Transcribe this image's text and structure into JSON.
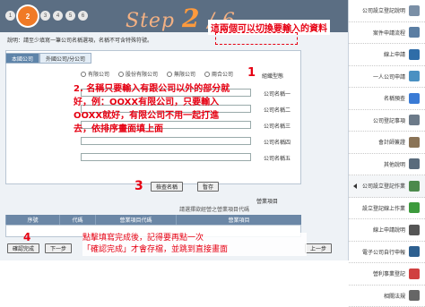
{
  "header": {
    "step_prefix": "Step",
    "step_number": "2",
    "step_suffix": "/ 6",
    "steps": [
      "1",
      "2",
      "3",
      "4",
      "5",
      "6"
    ],
    "current_step": "2"
  },
  "callouts": {
    "top": "這兩個可以切換要輸入的資料",
    "c1": "1",
    "c2_line1": "2. 名稱只要輸入有跟公司以外的部分就",
    "c2_line2": "好，例：OOXX有限公司，只要輸入",
    "c2_line3": "OOXX就好，有限公司不用一起打進",
    "c2_line4": "去，依排序畫面填上面",
    "c3": "3",
    "c4": "4",
    "bottom_line1": "點擊填寫完成後，記得要再點一次",
    "bottom_line2": "「確認完成」才會存檔，並跳到直接畫面"
  },
  "description": "說明：請至少填寫一筆公司名稱選項，名稱不可含特殊符號。",
  "tabs": [
    "本國公司",
    "外國公司/分公司"
  ],
  "form": {
    "type_label": "組織型態",
    "options": [
      "有限公司",
      "股份有限公司",
      "無限公司",
      "兩合公司"
    ],
    "name_labels": [
      "公司名稱一",
      "公司名稱二",
      "公司名稱三",
      "公司名稱四",
      "公司名稱五"
    ],
    "btn_save": "暫存",
    "btn_check": "檢查名稱",
    "section_label": "營業項目",
    "section_note": "請選擇欲經營之營業項目代碼"
  },
  "table": {
    "columns": [
      "序號",
      "代碼",
      "營業項目代碼",
      "營業項目"
    ]
  },
  "footer": {
    "btn_back": "上一步",
    "btn_next": "下一步",
    "btn_confirm": "確認完成"
  },
  "sidebar": {
    "items": [
      {
        "label": "公司設立登記說明",
        "icon": "info-icon",
        "color": "#7a8fa6"
      },
      {
        "label": "案件申請流程",
        "icon": "flow-icon",
        "color": "#5b7ea3"
      },
      {
        "label": "線上申請",
        "icon": "apply-icon",
        "color": "#2f6da8"
      },
      {
        "label": "一人公司申請",
        "icon": "person-icon",
        "color": "#4a90c2"
      },
      {
        "label": "名稱預查",
        "icon": "search-icon",
        "color": "#3a7bd5"
      },
      {
        "label": "公司登記事項",
        "icon": "list-icon",
        "color": "#6c7a89"
      },
      {
        "label": "會計師簽證",
        "icon": "doc-icon",
        "color": "#8a7356"
      },
      {
        "label": "其他說明",
        "icon": "book-icon",
        "color": "#5a6b7c"
      },
      {
        "label": "公司設立登記作業",
        "icon": "building-icon",
        "color": "#4c8a4c"
      },
      {
        "label": "設立登記線上作業",
        "icon": "check-icon",
        "color": "#3c9a3c"
      },
      {
        "label": "線上申請說明",
        "icon": "gamepad-icon",
        "color": "#555555"
      },
      {
        "label": "電子公司自行申報",
        "icon": "computer-icon",
        "color": "#2d5f8f"
      },
      {
        "label": "營利事業登記",
        "icon": "pencil-icon",
        "color": "#d04040"
      },
      {
        "label": "相關法規",
        "icon": "law-icon",
        "color": "#666666"
      }
    ]
  }
}
